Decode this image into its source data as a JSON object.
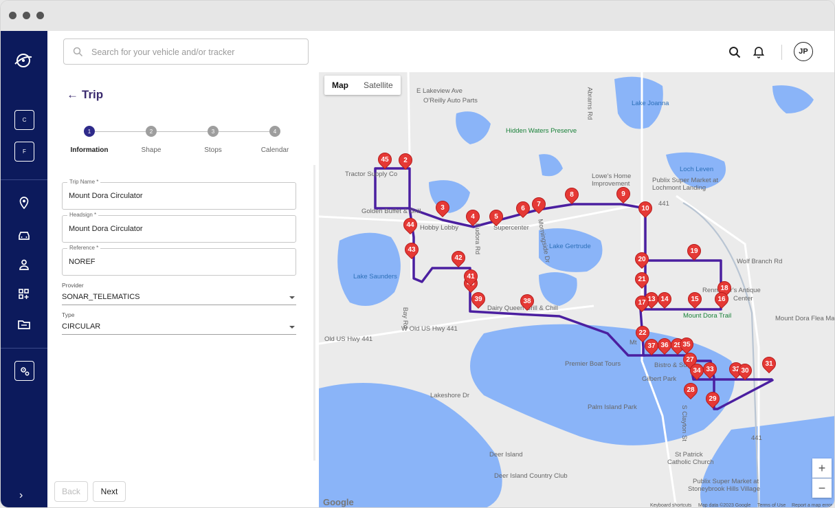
{
  "search": {
    "placeholder": "Search for your vehicle and/or tracker"
  },
  "user": {
    "initials": "JP"
  },
  "sidebar": {
    "company_box": "C",
    "fleet_box": "F"
  },
  "trip": {
    "title": "Trip",
    "steps": [
      {
        "num": "1",
        "label": "Information"
      },
      {
        "num": "2",
        "label": "Shape"
      },
      {
        "num": "3",
        "label": "Stops"
      },
      {
        "num": "4",
        "label": "Calendar"
      }
    ],
    "fields": {
      "trip_name": {
        "label": "Trip Name *",
        "value": "Mount Dora Circulator"
      },
      "headsign": {
        "label": "Headsign *",
        "value": "Mount Dora Circulator"
      },
      "reference": {
        "label": "Reference *",
        "value": "NOREF"
      }
    },
    "provider": {
      "label": "Provider",
      "value": "SONAR_TELEMATICS"
    },
    "type": {
      "label": "Type",
      "value": "CIRCULAR"
    },
    "back_label": "Back",
    "next_label": "Next"
  },
  "map": {
    "type_map": "Map",
    "type_satellite": "Satellite",
    "zoom_in": "+",
    "zoom_out": "−",
    "google": "Google",
    "attribution": {
      "shortcuts": "Keyboard shortcuts",
      "data": "Map data ©2023 Google",
      "terms": "Terms of Use",
      "report": "Report a map error"
    },
    "route_color": "#4b1fa0",
    "marker_color": "#e53935",
    "places": {
      "lakeview": "E Lakeview Ave",
      "oreilly": "O'Reilly Auto Parts",
      "hidden": "Hidden Waters Preserve",
      "lake_joanna": "Lake Joanna",
      "lowes1": "Lowe's Home",
      "lowes2": "Improvement",
      "publix1": "Publix Super Market at",
      "publix2": "Lochmont Landing",
      "loch_leven": "Loch Leven",
      "tractor": "Tractor Supply Co",
      "golden": "Golden Buffet & Grill",
      "hobby": "Hobby Lobby",
      "supercenter": "Supercenter",
      "lake_gertrude": "Lake Gertrude",
      "wolf": "Wolf Branch Rd",
      "lake_saunders": "Lake Saunders",
      "dairy": "Dairy Queen Grill & Chill",
      "renninger1": "Renninger's Antique",
      "renninger2": "Center",
      "trail": "Mount Dora Trail",
      "flea": "Mount Dora Flea Ma",
      "old_us": "Old US Hwy 441",
      "w_old_us": "W Old US Hwy 441",
      "boat": "Premier Boat Tours",
      "bistro": "Bistro & Su",
      "gilbert": "Gilbert Park",
      "palm": "Palm Island Park",
      "lakeshore": "Lakeshore Dr",
      "deer": "Deer Island",
      "deer_club": "Deer Island Country Club",
      "st_patrick1": "St Patrick",
      "st_patrick2": "Catholic Church",
      "publix3": "Publix Super Market at",
      "publix4": "Stoneybrook Hills Village",
      "mt": "Mt",
      "hwy441a": "441",
      "hwy441b": "441",
      "bay_rd": "Bay Rd",
      "clayton": "S Clayton St",
      "eudora": "Eudora Rd",
      "morningside": "Morningside Dr",
      "abrams": "Abrams Rd",
      "wolf_rd": "Wolf Branch Rd"
    },
    "stops": [
      "2",
      "3",
      "4",
      "5",
      "6",
      "7",
      "8",
      "9",
      "10",
      "14",
      "15",
      "16",
      "17",
      "18",
      "19",
      "20",
      "21",
      "13",
      "22",
      "27",
      "28",
      "29",
      "30",
      "31",
      "32",
      "33",
      "34",
      "35",
      "36",
      "37",
      "25",
      "38",
      "39",
      "40",
      "41",
      "42",
      "43",
      "44",
      "45"
    ]
  }
}
